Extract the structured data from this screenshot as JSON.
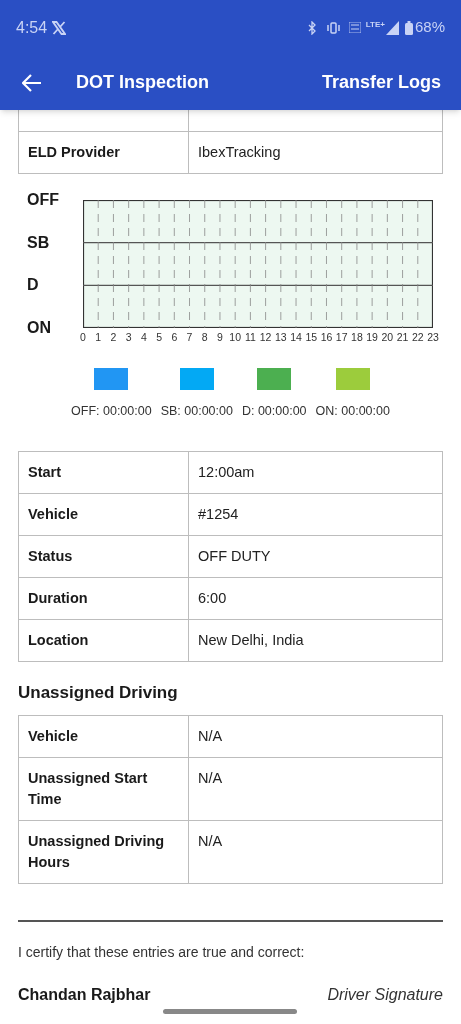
{
  "status_bar": {
    "time": "4:54",
    "network_label": "LTE+",
    "battery": "68%"
  },
  "app_bar": {
    "title": "DOT Inspection",
    "action": "Transfer Logs"
  },
  "eld_table": [
    {
      "label": "ELD Provider",
      "value": "IbexTracking"
    }
  ],
  "log_graph": {
    "y_labels": [
      "OFF",
      "SB",
      "D",
      "ON"
    ],
    "x_labels": [
      "0",
      "1",
      "2",
      "3",
      "4",
      "5",
      "6",
      "7",
      "8",
      "9",
      "10",
      "11",
      "12",
      "13",
      "14",
      "15",
      "16",
      "17",
      "18",
      "19",
      "20",
      "21",
      "22",
      "23"
    ]
  },
  "legend": [
    {
      "label": "OFF: 00:00:00",
      "color": "#2196f3"
    },
    {
      "label": "SB: 00:00:00",
      "color": "#03a9f4"
    },
    {
      "label": "D: 00:00:00",
      "color": "#4caf50"
    },
    {
      "label": "ON: 00:00:00",
      "color": "#9ccc3c"
    }
  ],
  "event_table": [
    {
      "label": "Start",
      "value": "12:00am"
    },
    {
      "label": "Vehicle",
      "value": "#1254"
    },
    {
      "label": "Status",
      "value": "OFF DUTY"
    },
    {
      "label": "Duration",
      "value": "6:00"
    },
    {
      "label": "Location",
      "value": "New Delhi, India"
    }
  ],
  "unassigned": {
    "title": "Unassigned Driving",
    "rows": [
      {
        "label": "Vehicle",
        "value": "N/A"
      },
      {
        "label": "Unassigned Start Time",
        "value": "N/A"
      },
      {
        "label": "Unassigned Driving Hours",
        "value": "N/A"
      }
    ]
  },
  "certification": {
    "statement": "I certify that these entries are true and correct:",
    "driver_name": "Chandan Rajbhar",
    "signature_label": "Driver Signature"
  }
}
